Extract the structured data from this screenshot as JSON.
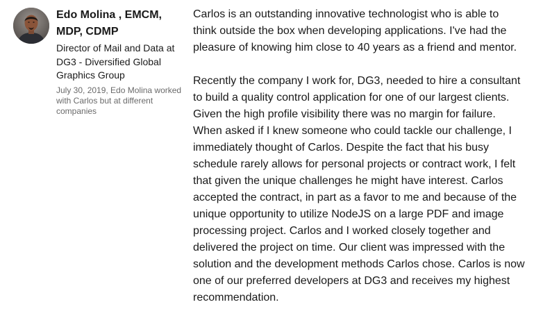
{
  "recommendation": {
    "author": {
      "name": "Edo Molina , EMCM, MDP, CDMP",
      "headline": "Director of Mail and Data at DG3 - Diversified Global Graphics Group",
      "meta": "July 30, 2019, Edo Molina worked with Carlos but at different companies",
      "avatar_icon": "profile-photo"
    },
    "paragraphs": [
      "Carlos is an outstanding innovative technologist who is able to think outside the box when developing applications. I've had the pleasure of knowing him close to 40 years as a friend and mentor.",
      "Recently the company I work for, DG3, needed to hire a consultant to build a quality control application for one of our largest clients. Given the high profile visibility there was no margin for failure. When asked if I knew someone who could tackle our challenge, I immediately thought of Carlos. Despite the fact that his busy schedule rarely allows for personal projects or contract work, I felt that given the unique challenges he might have interest. Carlos accepted the contract, in part as a favor to me and because of the unique opportunity to utilize NodeJS on a large PDF and image processing project. Carlos and I worked closely together and delivered the project on time. Our client was impressed with the solution and the development methods Carlos chose. Carlos is now one of our preferred developers at DG3 and receives my highest recommendation."
    ]
  }
}
